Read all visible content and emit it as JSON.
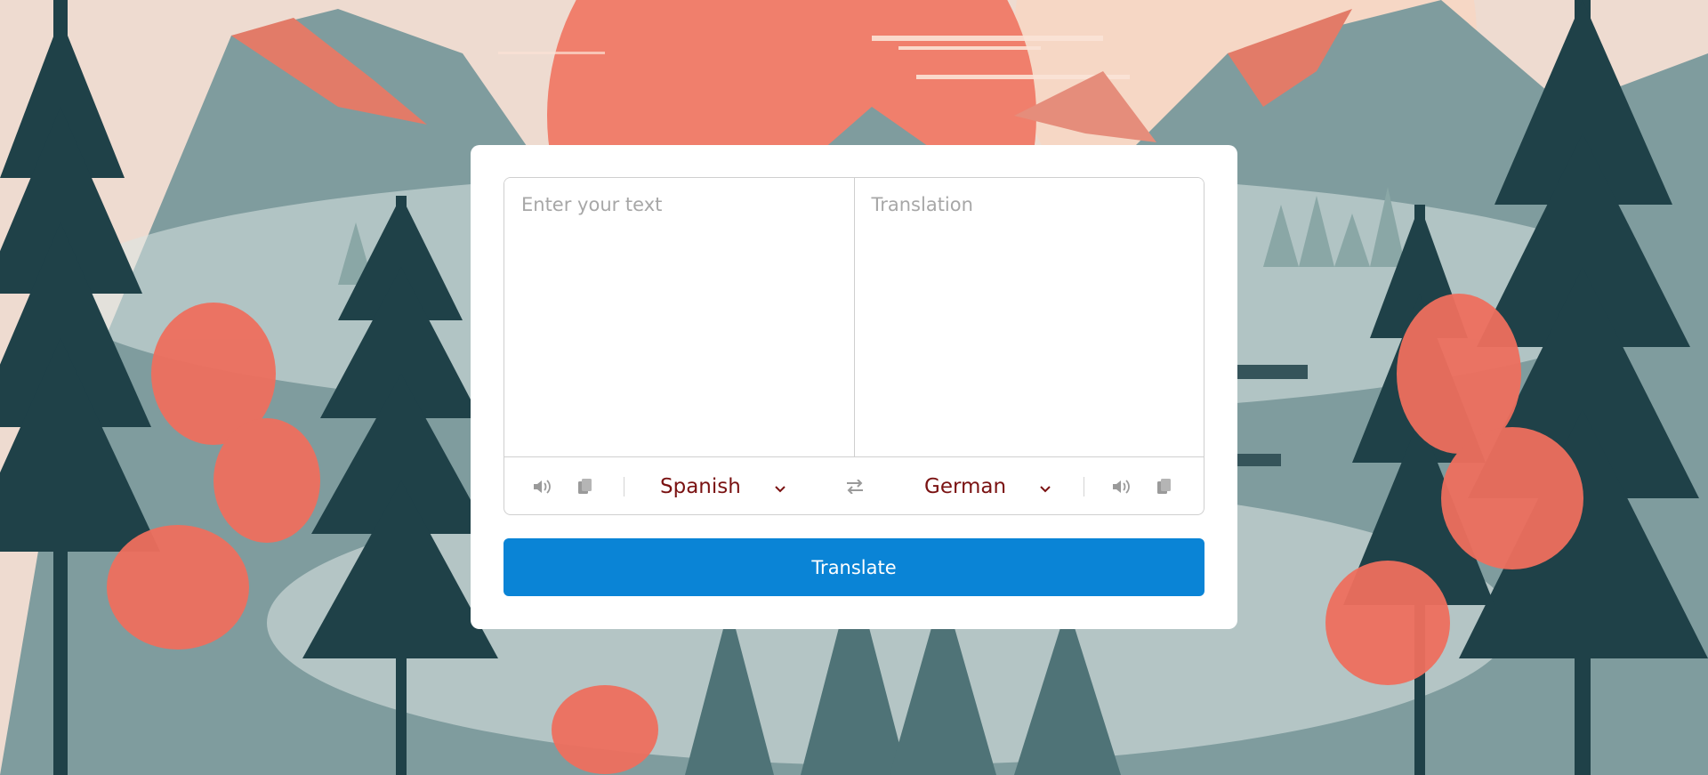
{
  "input": {
    "from_value": "",
    "from_placeholder": "Enter your text",
    "to_value": "",
    "to_placeholder": "Translation"
  },
  "controls": {
    "from_language": "Spanish",
    "to_language": "German",
    "icons": [
      "speaker-icon",
      "copy-icon",
      "swap-icon",
      "chevron-down-icon"
    ]
  },
  "actions": {
    "translate_label": "Translate"
  },
  "colors": {
    "accent": "#0a84d6",
    "language_text": "#7a1212",
    "icon_gray": "#9a9a9a",
    "border": "#cfcfcf"
  }
}
